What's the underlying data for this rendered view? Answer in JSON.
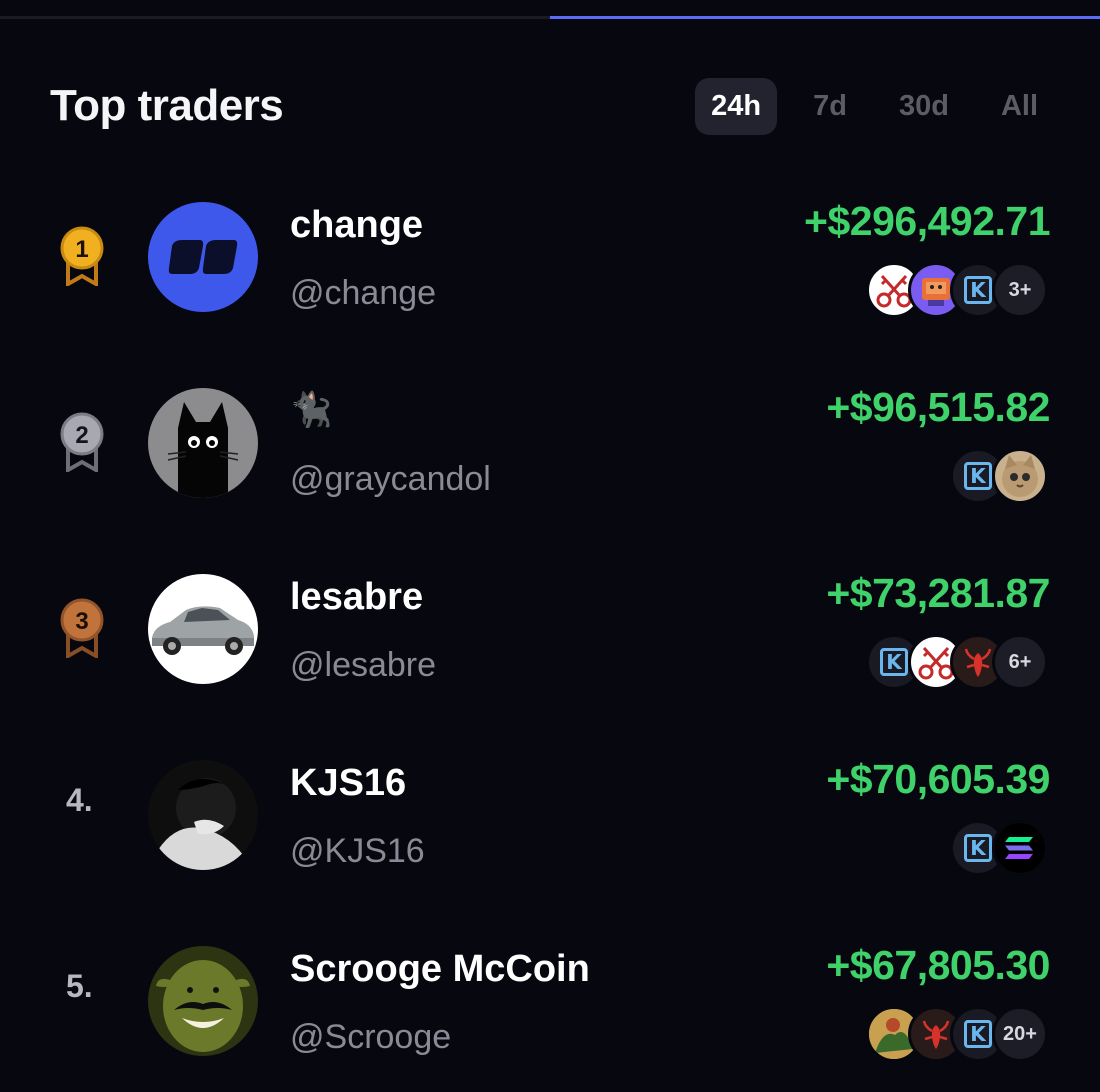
{
  "header": {
    "title": "Top traders",
    "tabs": [
      {
        "label": "24h",
        "active": true
      },
      {
        "label": "7d",
        "active": false
      },
      {
        "label": "30d",
        "active": false
      },
      {
        "label": "All",
        "active": false
      }
    ]
  },
  "progress": {
    "fraction": 0.5,
    "color": "#5b6cf5"
  },
  "colors": {
    "profit": "#3fd16a",
    "accent": "#5b6cf5",
    "background": "#07070f"
  },
  "traders": [
    {
      "rank": "1",
      "medal": "gold",
      "name": "change",
      "handle": "@change",
      "pnl": "+$296,492.71",
      "tokens": [
        "keys-icon",
        "robot-icon",
        "k-icon"
      ],
      "more": "3+"
    },
    {
      "rank": "2",
      "medal": "silver",
      "name": "🐈‍⬛",
      "handle": "@graycandol",
      "pnl": "+$96,515.82",
      "tokens": [
        "k-icon",
        "cat-icon"
      ],
      "more": ""
    },
    {
      "rank": "3",
      "medal": "bronze",
      "name": "lesabre",
      "handle": "@lesabre",
      "pnl": "+$73,281.87",
      "tokens": [
        "k-icon",
        "keys-icon",
        "lobster-icon"
      ],
      "more": "6+"
    },
    {
      "rank": "4.",
      "medal": "",
      "name": "KJS16",
      "handle": "@KJS16",
      "pnl": "+$70,605.39",
      "tokens": [
        "k-icon",
        "solana-icon"
      ],
      "more": ""
    },
    {
      "rank": "5.",
      "medal": "",
      "name": "Scrooge McCoin",
      "handle": "@Scrooge",
      "pnl": "+$67,805.30",
      "tokens": [
        "art-icon",
        "lobster-icon",
        "k-icon"
      ],
      "more": "20+"
    }
  ]
}
